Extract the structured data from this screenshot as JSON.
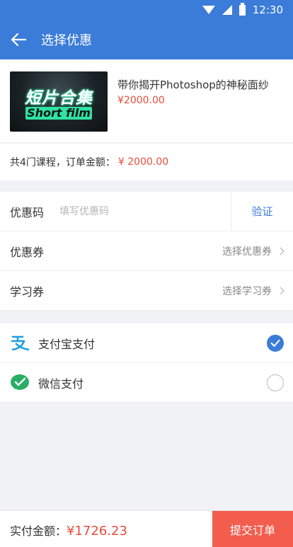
{
  "status_bar": {
    "time": "12:30"
  },
  "app_bar": {
    "title": "选择优惠",
    "back_icon": "arrow-left-icon"
  },
  "course": {
    "thumbnail_text_top": "短片合集",
    "thumbnail_text_bottom": "Short film",
    "title": "带你揭开Photoshop的神秘面纱",
    "price": "¥2000.00"
  },
  "summary": {
    "label": "共4门课程，订单金额：",
    "amount": "¥ 2000.00"
  },
  "discount": {
    "promo_code_label": "优惠码",
    "promo_code_placeholder": "填写优惠码",
    "verify_label": "验证",
    "coupon_label": "优惠券",
    "coupon_action": "选择优惠券",
    "study_voucher_label": "学习券",
    "study_voucher_action": "选择学习券"
  },
  "payment": {
    "methods": [
      {
        "label": "支付宝支付",
        "icon": "alipay-icon",
        "selected": true
      },
      {
        "label": "微信支付",
        "icon": "wechat-pay-icon",
        "selected": false
      }
    ]
  },
  "footer": {
    "total_label": "实付金额：",
    "total_value": "¥1726.23",
    "submit_label": "提交订单"
  },
  "colors": {
    "primary": "#3b7cd8",
    "price_red": "#e74c3c",
    "submit_bg": "#f25d4d",
    "alipay_blue": "#1a9fe0",
    "wechat_green": "#2aae67"
  }
}
